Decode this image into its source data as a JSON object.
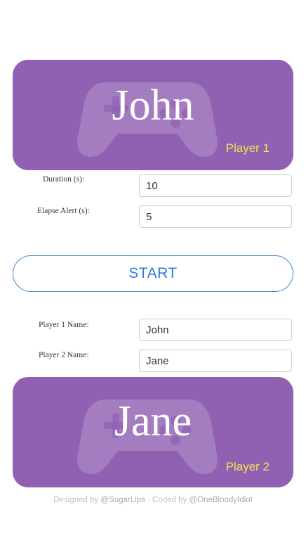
{
  "player1": {
    "name": "John",
    "label": "Player 1",
    "icon": "gamepad-icon"
  },
  "player2": {
    "name": "Jane",
    "label": "Player 2",
    "icon": "gamepad-icon"
  },
  "settings": {
    "duration_label": "Duration (s):",
    "duration_value": "10",
    "elapse_label": "Elapse Alert (s):",
    "elapse_value": "5"
  },
  "start_label": "START",
  "names": {
    "p1_label": "Player 1 Name:",
    "p1_value": "John",
    "p2_label": "Player 2 Name:",
    "p2_value": "Jane"
  },
  "footer": {
    "designed_prefix": "Designed by ",
    "designer": "@SugarLips",
    "sep": " · Coded by ",
    "coder": "@OneBloodyIdiot"
  },
  "colors": {
    "card": "#9061b3",
    "player_label": "#f7e34f",
    "accent": "#2f7bde"
  }
}
